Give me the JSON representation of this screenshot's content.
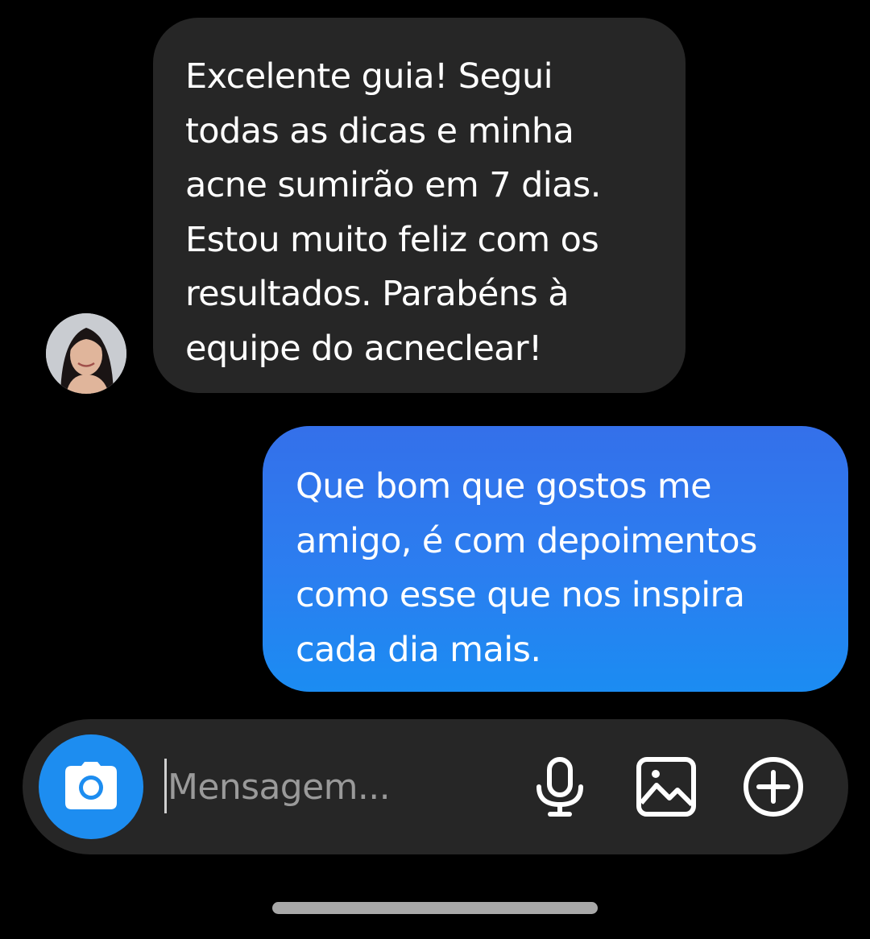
{
  "messages": [
    {
      "direction": "received",
      "text": "Excelente guia! Segui\ntodas as dicas e minha\nacne sumirão em 7 dias.\nEstou muito feliz com os\nresultados. Parabéns à\nequipe do acneclear!"
    },
    {
      "direction": "sent",
      "text": "Que bom que gostos me\namigo, é com depoimentos\ncomo esse que nos inspira\ncada dia mais."
    }
  ],
  "composer": {
    "placeholder": "Mensagem...",
    "value": "",
    "icons": [
      "camera-icon",
      "microphone-icon",
      "gallery-icon",
      "plus-circle-icon"
    ]
  },
  "colors": {
    "background": "#000000",
    "received_bubble": "#262626",
    "sent_bubble_top": "#3470ea",
    "sent_bubble_bottom": "#1b8cf2",
    "camera_button": "#1d8df0",
    "composer": "#262626"
  }
}
